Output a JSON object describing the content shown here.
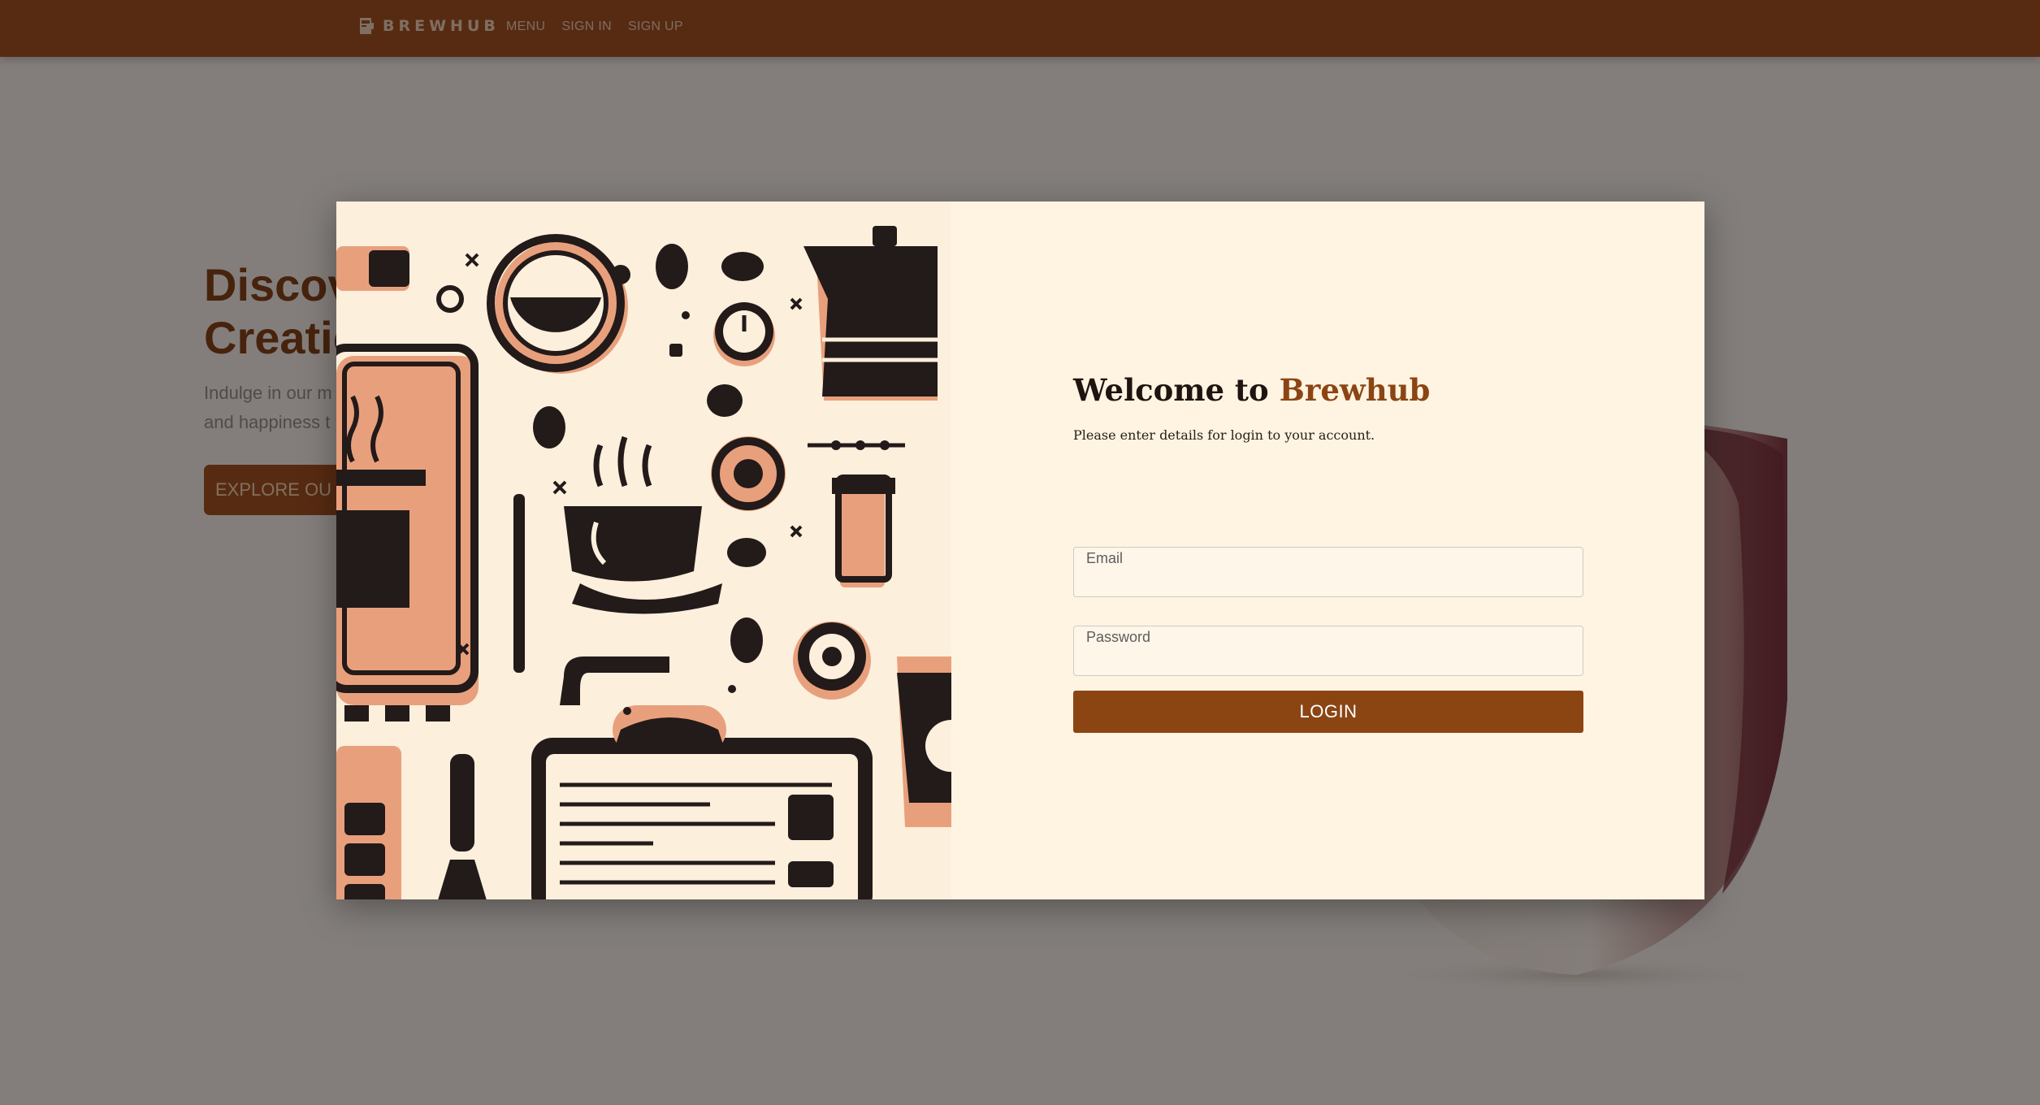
{
  "navbar": {
    "brand": "BREWHUB",
    "links": [
      "MENU",
      "SIGN IN",
      "SIGN UP"
    ],
    "bg_color": "#9b4a1c"
  },
  "hero": {
    "title": "Discov\nCreatic",
    "subtitle": "Indulge in our m\nand happiness t",
    "cta_label": "EXPLORE OU"
  },
  "modal": {
    "welcome_prefix": "Welcome to ",
    "welcome_brand": "Brewhub",
    "subtitle": "Please enter details for login to your account.",
    "email": {
      "label": "Email",
      "value": ""
    },
    "password": {
      "label": "Password",
      "value": ""
    },
    "login_label": "LOGIN",
    "accent_color": "#8b4513",
    "background_color": "#fff4e2"
  },
  "icons": [
    "coffee-brewhub-logo-icon",
    "coffee-illustration-image",
    "coffee-cup-image"
  ]
}
